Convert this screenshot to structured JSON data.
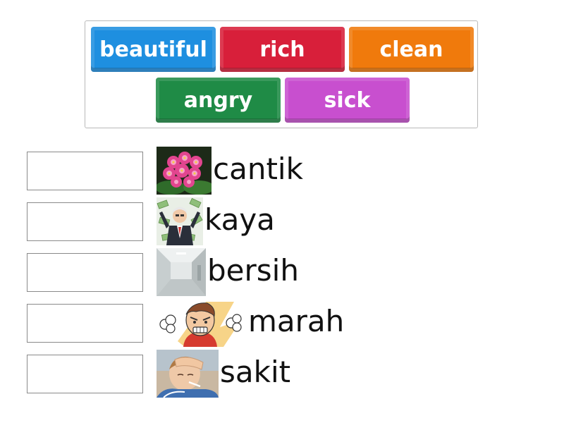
{
  "word_bank": {
    "tiles": [
      {
        "label": "beautiful",
        "color": "#1e8fe0",
        "icon": ""
      },
      {
        "label": "rich",
        "color": "#d81f3a",
        "icon": ""
      },
      {
        "label": "clean",
        "color": "#f07a0c",
        "icon": ""
      },
      {
        "label": "angry",
        "color": "#1f8b46",
        "icon": ""
      },
      {
        "label": "sick",
        "color": "#c84fcf",
        "icon": ""
      }
    ]
  },
  "rows": [
    {
      "word": "cantik",
      "image": "pink-flower-image"
    },
    {
      "word": "kaya",
      "image": "rich-man-money-image"
    },
    {
      "word": "bersih",
      "image": "clean-room-image"
    },
    {
      "word": "marah",
      "image": "angry-boy-image"
    },
    {
      "word": "sakit",
      "image": "sick-child-image"
    }
  ]
}
